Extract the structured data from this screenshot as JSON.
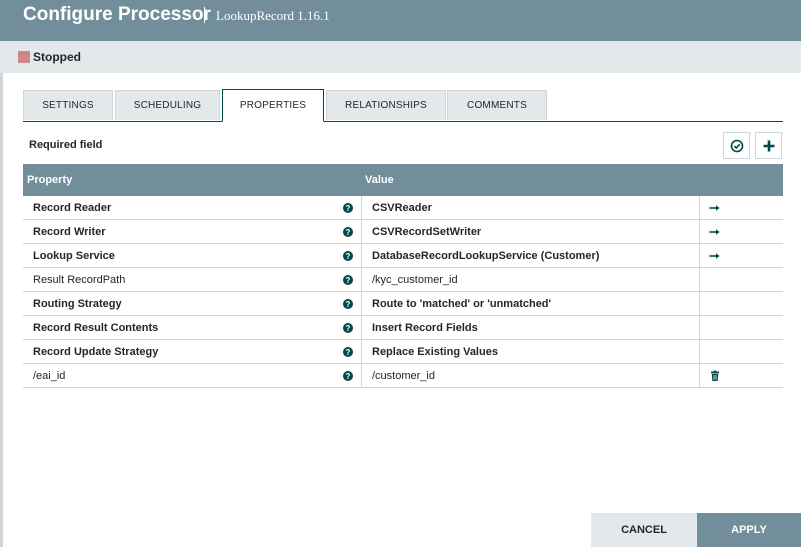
{
  "header": {
    "title": "Configure Processor",
    "subtitle": "LookupRecord 1.16.1"
  },
  "status": {
    "text": "Stopped",
    "color": "#d18686"
  },
  "tabs": [
    {
      "label": "SETTINGS",
      "active": false
    },
    {
      "label": "SCHEDULING",
      "active": false
    },
    {
      "label": "PROPERTIES",
      "active": true
    },
    {
      "label": "RELATIONSHIPS",
      "active": false
    },
    {
      "label": "COMMENTS",
      "active": false
    }
  ],
  "properties": {
    "required_label": "Required field",
    "verify_icon": "check-circle-icon",
    "add_icon": "plus-icon",
    "columns": {
      "property": "Property",
      "value": "Value"
    },
    "rows": [
      {
        "name": "Record Reader",
        "required": true,
        "value": "CSVReader",
        "action": "arrow-right-icon"
      },
      {
        "name": "Record Writer",
        "required": true,
        "value": "CSVRecordSetWriter",
        "action": "arrow-right-icon"
      },
      {
        "name": "Lookup Service",
        "required": true,
        "value": "DatabaseRecordLookupService (Customer)",
        "action": "arrow-right-icon"
      },
      {
        "name": "Result RecordPath",
        "required": false,
        "value": "/kyc_customer_id",
        "action": ""
      },
      {
        "name": "Routing Strategy",
        "required": true,
        "value": "Route to 'matched' or 'unmatched'",
        "action": ""
      },
      {
        "name": "Record Result Contents",
        "required": true,
        "value": "Insert Record Fields",
        "action": ""
      },
      {
        "name": "Record Update Strategy",
        "required": true,
        "value": "Replace Existing Values",
        "action": ""
      },
      {
        "name": "/eai_id",
        "required": false,
        "value": "/customer_id",
        "action": "trash-icon"
      }
    ]
  },
  "footer": {
    "cancel_label": "CANCEL",
    "apply_label": "APPLY"
  },
  "colors": {
    "header_bg": "#728e9b",
    "accent": "#004849",
    "status_bar_bg": "#e3e8eb"
  }
}
